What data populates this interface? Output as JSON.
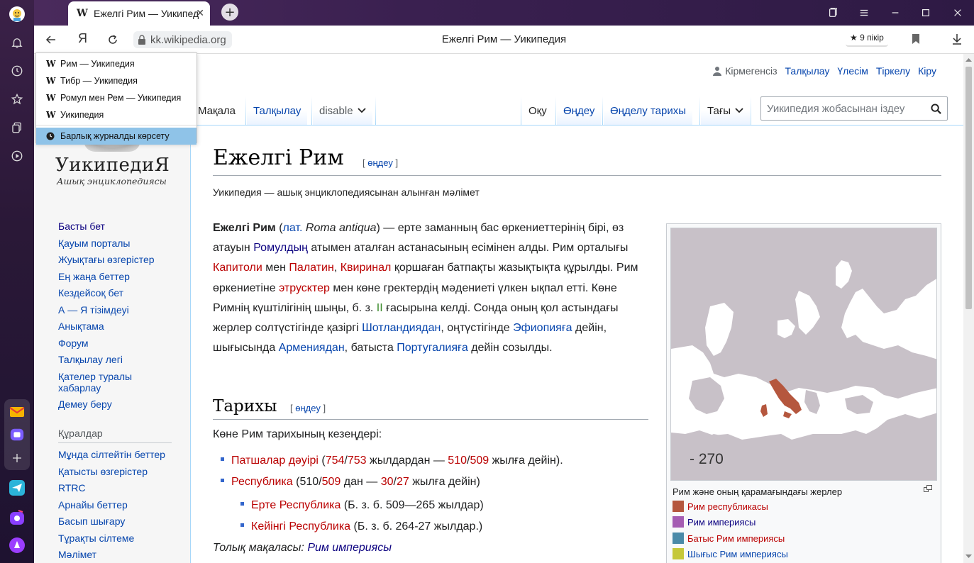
{
  "browser": {
    "tab_title": "Ежелгі Рим — Уикипедия",
    "tab_favicon": "W",
    "yandex_button": "Я",
    "url": "kk.wikipedia.org",
    "page_title": "Ежелгі Рим — Уикипедия",
    "reviews": "★ 9 пікір",
    "colors": {
      "tabbar": "#3a2050",
      "rail": "#2a1837",
      "selected_history": "#8fc3e8"
    }
  },
  "history_menu": {
    "items": [
      {
        "icon": "W",
        "label": "Рим — Уикипедия"
      },
      {
        "icon": "W",
        "label": "Тибр — Уикипедия"
      },
      {
        "icon": "W",
        "label": "Ромул мен Рем — Уикипедия"
      },
      {
        "icon": "W",
        "label": "Уикипедия"
      }
    ],
    "show_all": "Барлық журналды көрсету"
  },
  "wiki": {
    "logo_title": "УикипедиЯ",
    "logo_subtitle": "Ашық энциклопедиясы",
    "personal": {
      "anon": "Кірмегенсіз",
      "links": [
        "Талқылау",
        "Үлесім",
        "Тіркелу",
        "Кіру"
      ]
    },
    "nav": [
      "Басты бет",
      "Қауым порталы",
      "Жуықтағы өзгерістер",
      "Ең жаңа беттер",
      "Кездейсоқ бет",
      "А — Я тізімдеуі",
      "Анықтама",
      "Форум",
      "Талқылау легі",
      "Қателер туралы хабарлау",
      "Демеу беру"
    ],
    "tools_heading": "Құралдар",
    "tools": [
      "Мұнда сілтейтін беттер",
      "Қатысты өзгерістер",
      "RTRC",
      "Арнайы беттер",
      "Басып шығару",
      "Тұрақты сілтеме",
      "Мәлімет"
    ],
    "tabs_left": {
      "article": "Мақала",
      "talk": "Талқылау",
      "variant": "disable"
    },
    "tabs_right": {
      "read": "Оқу",
      "edit": "Өңдеу",
      "history": "Өңделу тарихы",
      "more": "Тағы"
    },
    "search_placeholder": "Уикипедия жобасынан іздеу",
    "title": "Ежелгі Рим",
    "edit_label": "өңдеу",
    "tagline": "Уикипедия — ашық энциклопедиясынан алынған мәлімет",
    "lead": {
      "b1": "Ежелгі Рим",
      "t1": " (",
      "l1": "лат.",
      "t2": " ",
      "i1": "Roma antiqua",
      "t3": ") — ерте заманның бас өркениеттерінің бірі, өз атауын ",
      "l2": "Ромулдың",
      "t4": " атымен аталған астанасының есімінен алды. Рим орталығы ",
      "r1": "Капитоли",
      "t5": " мен ",
      "r2": "Палатин",
      "t6": ", ",
      "r3": "Квиринал",
      "t7": " қоршаған батпақты жазықтықта құрылды. Рим өркениетіне ",
      "r4": "этрусктер",
      "t8": " мен көне гректердің мәдениеті үлкен ықпал етті. Көне Римнің күштілігінің шыңы, б. з. ",
      "g1": "II",
      "t9": " ғасырына келді. Сонда оның қол астындағы жерлер солтүстігінде қазіргі ",
      "l3": "Шотландиядан",
      "t10": ", оңтүстігінде ",
      "l4": "Эфиопияға",
      "t11": " дейін, шығысында ",
      "l5": "Армениядан",
      "t12": ", батыста ",
      "l6": "Португалияға",
      "t13": " дейін созылды."
    },
    "history_heading": "Тарихы",
    "periods_intro": "Көне Рим тарихының кезеңдері:",
    "periods": {
      "p1": {
        "link": "Патшалар дәуірі",
        "t1": " (",
        "a": "754",
        "s1": "/",
        "b": "753",
        "t2": " жылдардан — ",
        "c": "510",
        "s2": "/",
        "d": "509",
        "t3": " жылға дейін)."
      },
      "p2": {
        "link": "Республика",
        "t1": " (510/",
        "a": "509",
        "t2": " дан — ",
        "b": "30",
        "s1": "/",
        "c": "27",
        "t3": " жылға дейін)"
      },
      "p3": {
        "link": "Ерте Республика",
        "t1": " (Б. з. б. 509—265 жылдар)"
      },
      "p4": {
        "link": "Кейінгі Республика",
        "t1": " (Б. з. б. 264-27 жылдар.)"
      }
    },
    "full_article_prefix": "Толық мақаласы: ",
    "full_article_link": "Рим империясы",
    "infobox": {
      "map_year": "- 270",
      "caption": "Рим және оның қарамағындағы жерлер",
      "legend": [
        {
          "label": "Рим республикасы",
          "color": "#b5573e",
          "link_color": "red"
        },
        {
          "label": "Рим империясы",
          "color": "#a55db3",
          "link_color": "dblue"
        },
        {
          "label": "Батыс Рим империясы",
          "color": "#4a8aa8",
          "link_color": "red"
        },
        {
          "label": "Шығыс Рим империясы",
          "color": "#c5c83a",
          "link_color": "blue"
        }
      ],
      "map_colors": {
        "land": "#c8c1c8",
        "sea": "#ffffff",
        "rome": "#b5573e"
      }
    }
  }
}
